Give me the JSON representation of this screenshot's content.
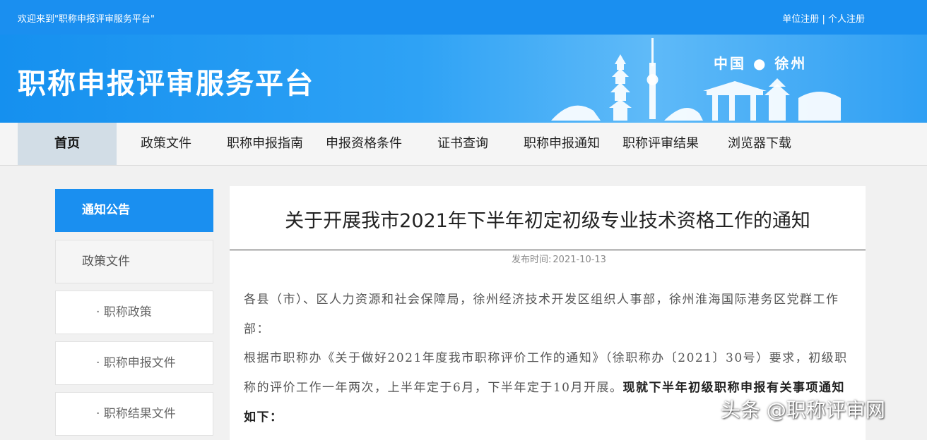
{
  "topbar": {
    "welcome": "欢迎来到\"职称申报评审服务平台\"",
    "unit_register": "单位注册",
    "separator": "|",
    "personal_register": "个人注册"
  },
  "banner": {
    "title": "职称申报评审服务平台",
    "city": "中国 ● 徐州"
  },
  "nav": {
    "items": [
      "首页",
      "政策文件",
      "职称申报指南",
      "申报资格条件",
      "证书查询",
      "职称申报通知",
      "职称评审结果",
      "浏览器下载"
    ],
    "active": "首页"
  },
  "sidebar": {
    "header": "通知公告",
    "section": "政策文件",
    "subitems": [
      "· 职称政策",
      "· 职称申报文件",
      "· 职称结果文件"
    ]
  },
  "article": {
    "title": "关于开展我市2021年下半年初定初级专业技术资格工作的通知",
    "date_label": "发布时间:",
    "date": "2021-10-13",
    "para1": "各县（市）、区人力资源和社会保障局，徐州经济技术开发区组织人事部，徐州淮海国际港务区党群工作部：",
    "para2_normal": "根据市职称办《关于做好2021年度我市职称评价工作的通知》（徐职称办〔2021〕30号）要求，初级职称的评价工作一年两次，上半年定于6月，下半年定于10月开展。",
    "para2_bold": "现就下半年初级职称申报有关事项通知如下："
  },
  "watermark": "头条 @职称评审网",
  "colors": {
    "brand_blue": "#1a8ff0",
    "nav_active": "#d2dde6"
  }
}
